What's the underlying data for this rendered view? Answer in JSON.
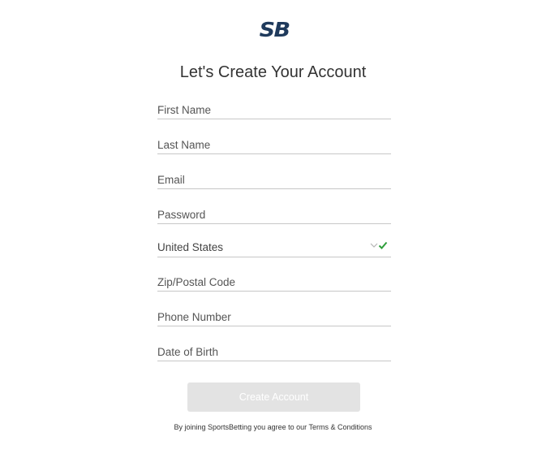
{
  "logo": {
    "text": "SB",
    "color": "#1f3a5c"
  },
  "header": {
    "title": "Let's Create Your Account"
  },
  "form": {
    "first_name": {
      "placeholder": "First Name",
      "value": ""
    },
    "last_name": {
      "placeholder": "Last Name",
      "value": ""
    },
    "email": {
      "placeholder": "Email",
      "value": ""
    },
    "password": {
      "placeholder": "Password",
      "value": ""
    },
    "country": {
      "selected": "United States",
      "valid": true,
      "icons": [
        "chevron-down-icon",
        "check-icon"
      ]
    },
    "zip": {
      "placeholder": "Zip/Postal Code",
      "value": ""
    },
    "phone": {
      "placeholder": "Phone Number",
      "value": ""
    },
    "dob": {
      "placeholder": "Date of Birth",
      "value": ""
    }
  },
  "actions": {
    "create_label": "Create Account",
    "disabled": true
  },
  "footer": {
    "terms_prefix": "By joining SportsBetting you agree to our ",
    "terms_link": "Terms & Conditions"
  },
  "colors": {
    "brand": "#1f3a5c",
    "valid_check": "#2e9e3a",
    "field_border": "#c7c7c7",
    "button_disabled": "#e3e3e3"
  }
}
